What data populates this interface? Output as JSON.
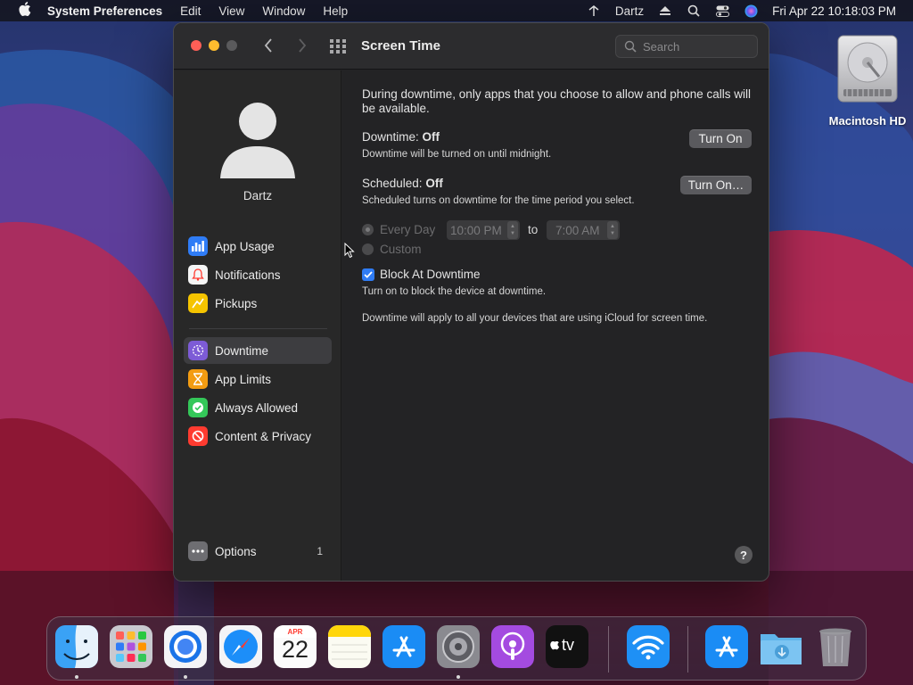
{
  "menubar": {
    "app_name": "System Preferences",
    "items": [
      "Edit",
      "View",
      "Window",
      "Help"
    ],
    "user": "Dartz",
    "datetime": "Fri Apr 22  10:18:03 PM"
  },
  "desktop": {
    "icon_label": "Macintosh HD"
  },
  "window": {
    "title": "Screen Time",
    "search_placeholder": "Search"
  },
  "sidebar": {
    "username": "Dartz",
    "items": [
      {
        "label": "App Usage",
        "icon": "bar-chart-icon",
        "color": "#2f7cf6"
      },
      {
        "label": "Notifications",
        "icon": "bell-icon",
        "color": "#ff3b30"
      },
      {
        "label": "Pickups",
        "icon": "pickups-icon",
        "color": "#f5c400"
      },
      {
        "label": "Downtime",
        "icon": "downtime-icon",
        "color": "#7d5bd6",
        "selected": true
      },
      {
        "label": "App Limits",
        "icon": "hourglass-icon",
        "color": "#f39c12"
      },
      {
        "label": "Always Allowed",
        "icon": "checkmark-icon",
        "color": "#34c759"
      },
      {
        "label": "Content & Privacy",
        "icon": "no-entry-icon",
        "color": "#ff3b30"
      }
    ],
    "options": {
      "label": "Options",
      "badge": "1"
    }
  },
  "content": {
    "intro": "During downtime, only apps that you choose to allow and phone calls will be available.",
    "downtime": {
      "label": "Downtime:",
      "state": "Off",
      "description": "Downtime will be turned on until midnight.",
      "button": "Turn On"
    },
    "scheduled": {
      "label": "Scheduled:",
      "state": "Off",
      "description": "Scheduled turns on downtime for the time period you select.",
      "button": "Turn On…"
    },
    "schedule": {
      "every_day": "Every Day",
      "custom": "Custom",
      "start_time": "10:00 PM",
      "to": "to",
      "end_time": "7:00 AM"
    },
    "block": {
      "label": "Block At Downtime",
      "checked": true,
      "description": "Turn on to block the device at downtime."
    },
    "icloud_note": "Downtime will apply to all your devices that are using iCloud for screen time.",
    "help": "?"
  },
  "dock": {
    "apps": [
      "finder",
      "launchpad",
      "chrome",
      "safari",
      "calendar",
      "notes",
      "app-store",
      "system-preferences",
      "podcasts",
      "apple-tv",
      "wifi",
      "app-store-downloads",
      "downloads-folder",
      "trash"
    ],
    "calendar_month": "APR",
    "calendar_day": "22",
    "tv_label": "tv"
  }
}
